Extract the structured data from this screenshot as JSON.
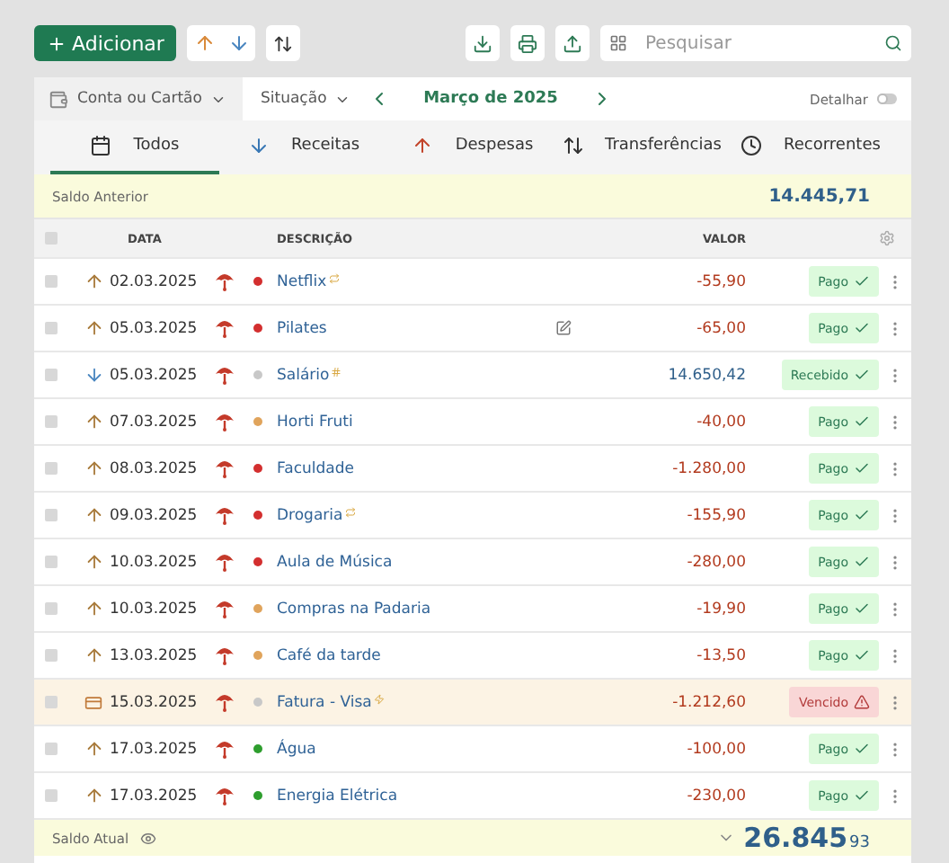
{
  "toolbar": {
    "add_label": "Adicionar",
    "search": {
      "placeholder": "Pesquisar"
    }
  },
  "filters": {
    "account": "Conta ou Cartão",
    "status": "Situação",
    "period": "Março de 2025",
    "detail": {
      "label": "Detalhar",
      "on": false
    }
  },
  "tabs": [
    {
      "label": "Todos",
      "selected": true
    },
    {
      "label": "Receitas",
      "selected": false
    },
    {
      "label": "Despesas",
      "selected": false
    },
    {
      "label": "Transferências",
      "selected": false
    },
    {
      "label": "Recorrentes",
      "selected": false
    }
  ],
  "previous_balance": {
    "label": "Saldo Anterior",
    "value": "14.445,71"
  },
  "table": {
    "select_all": {
      "checked": false
    },
    "columns": [
      "DATA",
      "DESCRIÇÃO",
      "VALOR"
    ],
    "rows": [
      {
        "kind": "expense",
        "date": "02.03.2025",
        "color": "#d32f2f",
        "description": "Netflix",
        "marker": {
          "kind": "recurring"
        },
        "note": false,
        "value": "-55,90",
        "status": {
          "kind": "paid",
          "label": "Pago"
        },
        "overdue": false
      },
      {
        "kind": "expense",
        "date": "05.03.2025",
        "color": "#d32f2f",
        "description": "Pilates",
        "note": true,
        "value": "-65,00",
        "status": {
          "kind": "paid",
          "label": "Pago"
        },
        "overdue": false
      },
      {
        "kind": "income",
        "date": "05.03.2025",
        "color": "#c8c8c8",
        "description": "Salário",
        "marker": {
          "kind": "installment"
        },
        "note": false,
        "value": "14.650,42",
        "status": {
          "kind": "paid",
          "label": "Recebido"
        },
        "overdue": false
      },
      {
        "kind": "expense",
        "date": "07.03.2025",
        "color": "#e0a45c",
        "description": "Horti Fruti",
        "note": false,
        "value": "-40,00",
        "status": {
          "kind": "paid",
          "label": "Pago"
        },
        "overdue": false
      },
      {
        "kind": "expense",
        "date": "08.03.2025",
        "color": "#d32f2f",
        "description": "Faculdade",
        "note": false,
        "value": "-1.280,00",
        "status": {
          "kind": "paid",
          "label": "Pago"
        },
        "overdue": false
      },
      {
        "kind": "expense",
        "date": "09.03.2025",
        "color": "#d32f2f",
        "description": "Drogaria",
        "marker": {
          "kind": "recurring"
        },
        "note": false,
        "value": "-155,90",
        "status": {
          "kind": "paid",
          "label": "Pago"
        },
        "overdue": false
      },
      {
        "kind": "expense",
        "date": "10.03.2025",
        "color": "#d32f2f",
        "description": "Aula de Música",
        "note": false,
        "value": "-280,00",
        "status": {
          "kind": "paid",
          "label": "Pago"
        },
        "overdue": false
      },
      {
        "kind": "expense",
        "date": "10.03.2025",
        "color": "#e0a45c",
        "description": "Compras na Padaria",
        "note": false,
        "value": "-19,90",
        "status": {
          "kind": "paid",
          "label": "Pago"
        },
        "overdue": false
      },
      {
        "kind": "expense",
        "date": "13.03.2025",
        "color": "#e0a45c",
        "description": "Café da tarde",
        "note": false,
        "value": "-13,50",
        "status": {
          "kind": "paid",
          "label": "Pago"
        },
        "overdue": false
      },
      {
        "kind": "card",
        "date": "15.03.2025",
        "color": "#c8c8c8",
        "description": "Fatura - Visa",
        "marker": {
          "kind": "alert"
        },
        "note": false,
        "value": "-1.212,60",
        "status": {
          "kind": "overdue",
          "label": "Vencido"
        },
        "overdue": true
      },
      {
        "kind": "expense",
        "date": "17.03.2025",
        "color": "#2e9e2e",
        "description": "Água",
        "note": false,
        "value": "-100,00",
        "status": {
          "kind": "paid",
          "label": "Pago"
        },
        "overdue": false
      },
      {
        "kind": "expense",
        "date": "17.03.2025",
        "color": "#2e9e2e",
        "description": "Energia Elétrica",
        "note": false,
        "value": "-230,00",
        "status": {
          "kind": "paid",
          "label": "Pago"
        },
        "overdue": false
      }
    ]
  },
  "current_balance": {
    "label": "Saldo Atual",
    "value": "26.845",
    "cents": "93"
  }
}
